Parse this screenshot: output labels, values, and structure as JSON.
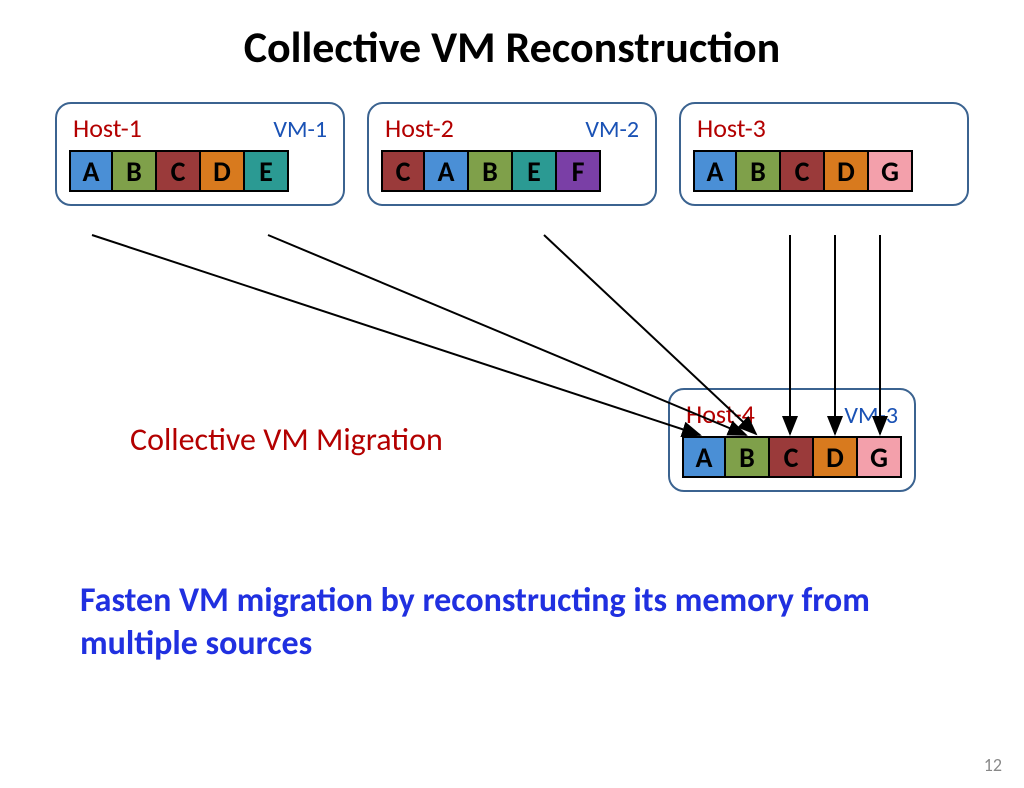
{
  "title": "Collective VM Reconstruction",
  "hosts": {
    "h1": {
      "label": "Host-1",
      "vm": "VM-1",
      "blocks": [
        "A",
        "B",
        "C",
        "D",
        "E"
      ]
    },
    "h2": {
      "label": "Host-2",
      "vm": "VM-2",
      "blocks": [
        "C",
        "A",
        "B",
        "E",
        "F"
      ]
    },
    "h3": {
      "label": "Host-3",
      "vm": "",
      "blocks": [
        "A",
        "B",
        "C",
        "D",
        "G"
      ]
    },
    "h4": {
      "label": "Host-4",
      "vm": "VM-3",
      "blocks": [
        "A",
        "B",
        "C",
        "D",
        "G"
      ]
    }
  },
  "migration_label": "Collective VM Migration",
  "conclusion": "Fasten VM migration by reconstructing its memory from multiple sources",
  "page_number": "12",
  "colors": {
    "A": "#4a8fd6",
    "B": "#7fa04a",
    "C": "#9a3a3a",
    "D": "#d87a1e",
    "E": "#2b9a93",
    "F": "#7a3fa6",
    "G": "#f3a0ab"
  }
}
